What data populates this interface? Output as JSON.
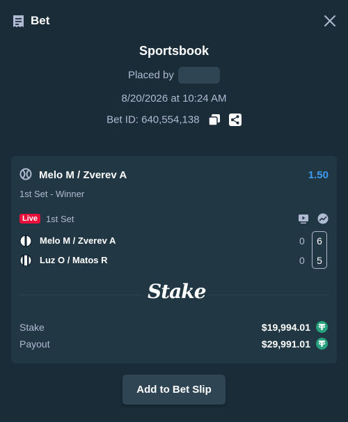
{
  "header": {
    "title": "Bet"
  },
  "bet": {
    "section": "Sportsbook",
    "placed_by_label": "Placed by",
    "datetime": "8/20/2026 at 10:24 AM",
    "bet_id_label": "Bet ID: 640,554,138"
  },
  "event": {
    "name": "Melo M / Zverev A",
    "odds": "1.50",
    "market": "1st Set - Winner",
    "live_badge": "Live",
    "period": "1st Set",
    "teams": [
      {
        "name": "Melo M / Zverev A",
        "score": "0",
        "current": "6"
      },
      {
        "name": "Luz O / Matos R",
        "score": "0",
        "current": "5"
      }
    ]
  },
  "brand": {
    "logo_text": "Stake"
  },
  "summary": {
    "stake_label": "Stake",
    "stake_value": "$19,994.01",
    "payout_label": "Payout",
    "payout_value": "$29,991.01"
  },
  "actions": {
    "add_to_slip": "Add to Bet Slip"
  },
  "icons": {
    "header": "receipt-icon",
    "close": "close-icon",
    "copy": "copy-icon",
    "share": "share-icon",
    "sport": "tennis-ball-icon",
    "tv": "tv-icon",
    "stats": "stats-icon",
    "currency": "tether-coin-icon"
  },
  "colors": {
    "background": "#1a2c38",
    "card": "#213743",
    "muted_text": "#b1bad3",
    "odds": "#3d9bf0",
    "live": "#e9113c",
    "coin": "#26a17b",
    "button": "#2f4553"
  }
}
